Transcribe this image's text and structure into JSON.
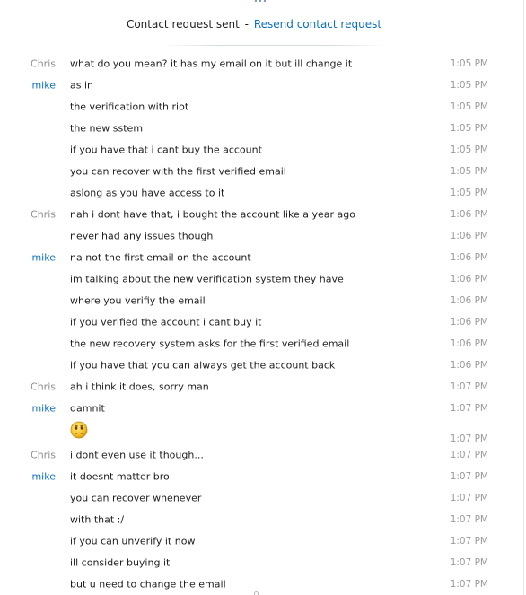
{
  "header": {
    "status": "Contact request sent",
    "separator": "-",
    "resend_label": "Resend contact request"
  },
  "colors": {
    "link_blue": "#0a6fc2",
    "sender_grey": "#8c8c8c",
    "time_grey": "#9a9a9a",
    "text": "#1e1e1e"
  },
  "emoji_icon": "worried-face-icon",
  "messages": [
    {
      "sender": "Chris",
      "text": "what do you mean? it has my email on it but ill change it",
      "time": "1:05 PM"
    },
    {
      "sender": "mike",
      "text": "as in",
      "time": "1:05 PM"
    },
    {
      "sender": "",
      "text": "the verification with riot",
      "time": "1:05 PM"
    },
    {
      "sender": "",
      "text": "the new sstem",
      "time": "1:05 PM"
    },
    {
      "sender": "",
      "text": "if you have that i cant buy the account",
      "time": "1:05 PM"
    },
    {
      "sender": "",
      "text": "you can recover with the first verified email",
      "time": "1:05 PM"
    },
    {
      "sender": "",
      "text": "aslong as you have access to it",
      "time": "1:05 PM"
    },
    {
      "sender": "Chris",
      "text": "nah i dont have that, i bought the account like a year ago",
      "time": "1:06 PM"
    },
    {
      "sender": "",
      "text": "never had any issues though",
      "time": "1:06 PM"
    },
    {
      "sender": "mike",
      "text": "na not the first email on the account",
      "time": "1:06 PM"
    },
    {
      "sender": "",
      "text": "im talking about the new verification system they have",
      "time": "1:06 PM"
    },
    {
      "sender": "",
      "text": "where you verifiy the email",
      "time": "1:06 PM"
    },
    {
      "sender": "",
      "text": "if you verified the account i cant buy it",
      "time": "1:06 PM"
    },
    {
      "sender": "",
      "text": "the new recovery system asks for the first verified email",
      "time": "1:06 PM"
    },
    {
      "sender": "",
      "text": "if you have that you can always get the account back",
      "time": "1:06 PM"
    },
    {
      "sender": "Chris",
      "text": "ah i think it does, sorry man",
      "time": "1:07 PM"
    },
    {
      "sender": "mike",
      "text": "damnit",
      "time": "1:07 PM"
    },
    {
      "sender": "",
      "text": "",
      "time": "1:07 PM"
    },
    {
      "sender": "Chris",
      "text": "i dont even use it though...",
      "time": "1:07 PM"
    },
    {
      "sender": "mike",
      "text": "it doesnt matter bro",
      "time": "1:07 PM"
    },
    {
      "sender": "",
      "text": "you can recover whenever",
      "time": "1:07 PM"
    },
    {
      "sender": "",
      "text": "with that :/",
      "time": "1:07 PM"
    },
    {
      "sender": "",
      "text": "if you can unverify it now",
      "time": "1:07 PM"
    },
    {
      "sender": "",
      "text": "ill consider buying it",
      "time": "1:07 PM"
    },
    {
      "sender": "",
      "text": "but u need to change the email",
      "time": "1:07 PM"
    }
  ]
}
